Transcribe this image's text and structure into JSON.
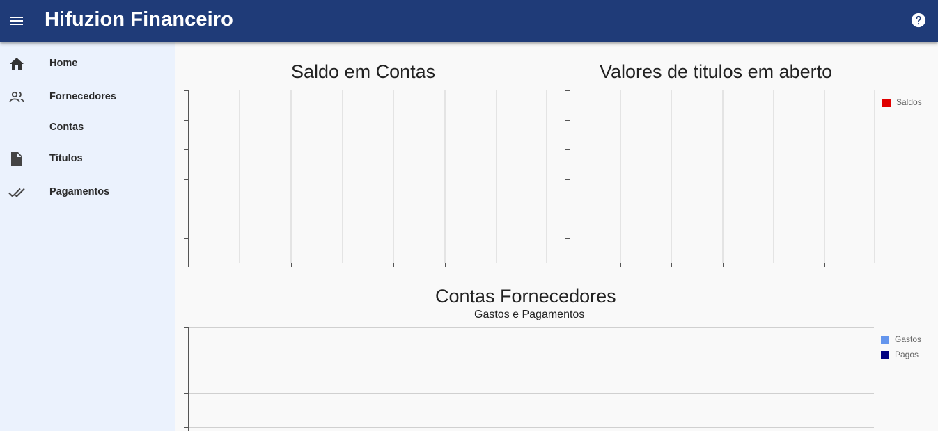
{
  "topbar": {
    "title": "Hifuzion Financeiro",
    "menu_icon": "menu-icon",
    "help_icon": "help-icon",
    "background": "#1f3b78"
  },
  "sidebar": {
    "items": [
      {
        "label": "Home",
        "icon": "home-icon"
      },
      {
        "label": "Fornecedores",
        "icon": "people-icon"
      },
      {
        "label": "Contas",
        "icon": ""
      },
      {
        "label": "Títulos",
        "icon": "document-icon"
      },
      {
        "label": "Pagamentos",
        "icon": "double-check-icon"
      }
    ]
  },
  "charts": {
    "saldo": {
      "title": "Saldo em Contas"
    },
    "titulos": {
      "title": "Valores de titulos em aberto",
      "legend": [
        {
          "label": "Saldos",
          "color": "#e00000"
        }
      ]
    },
    "fornecedores": {
      "title": "Contas Fornecedores",
      "subtitle": "Gastos e Pagamentos",
      "legend": [
        {
          "label": "Gastos",
          "color": "#6495ed"
        },
        {
          "label": "Pagos",
          "color": "#000080"
        }
      ]
    }
  },
  "chart_data": [
    {
      "type": "bar",
      "title": "Saldo em Contas",
      "categories": [],
      "values": [],
      "grid": true
    },
    {
      "type": "bar",
      "title": "Valores de titulos em aberto",
      "categories": [],
      "series": [
        {
          "name": "Saldos",
          "values": []
        }
      ],
      "legend": "right",
      "grid": true
    },
    {
      "type": "bar",
      "title": "Contas Fornecedores",
      "subtitle": "Gastos e Pagamentos",
      "categories": [],
      "series": [
        {
          "name": "Gastos",
          "values": []
        },
        {
          "name": "Pagos",
          "values": []
        }
      ],
      "legend": "right",
      "grid": true
    }
  ]
}
